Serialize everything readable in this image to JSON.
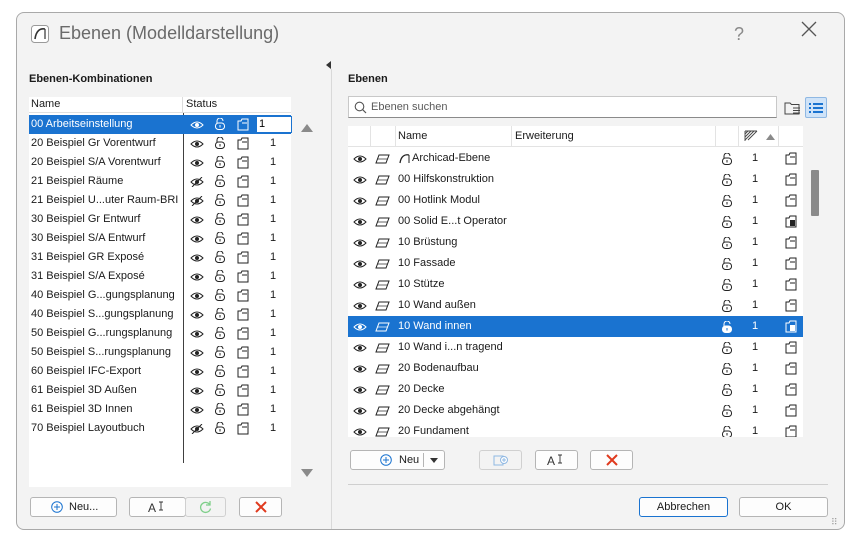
{
  "window": {
    "title": "Ebenen (Modelldarstellung)",
    "help_label": "?"
  },
  "left": {
    "section_title": "Ebenen-Kombinationen",
    "col_name": "Name",
    "col_status": "Status",
    "rows": [
      {
        "name": "00 Arbeitseinstellung",
        "num": "1",
        "hidden": false,
        "selected": true
      },
      {
        "name": "20 Beispiel Gr Vorentwurf",
        "num": "1",
        "hidden": false
      },
      {
        "name": "20 Beispiel S/A Vorentwurf",
        "num": "1",
        "hidden": false
      },
      {
        "name": "21 Beispiel Räume",
        "num": "1",
        "hidden": true
      },
      {
        "name": "21 Beispiel U...uter Raum-BRI",
        "num": "1",
        "hidden": true
      },
      {
        "name": "30 Beispiel Gr Entwurf",
        "num": "1",
        "hidden": false
      },
      {
        "name": "30 Beispiel S/A Entwurf",
        "num": "1",
        "hidden": false
      },
      {
        "name": "31 Beispiel GR Exposé",
        "num": "1",
        "hidden": false
      },
      {
        "name": "31 Beispiel S/A Exposé",
        "num": "1",
        "hidden": false
      },
      {
        "name": "40 Beispiel G...gungsplanung",
        "num": "1",
        "hidden": false
      },
      {
        "name": "40 Beispiel S...gungsplanung",
        "num": "1",
        "hidden": false
      },
      {
        "name": "50 Beispiel G...rungsplanung",
        "num": "1",
        "hidden": false
      },
      {
        "name": "50 Beispiel S...rungsplanung",
        "num": "1",
        "hidden": false
      },
      {
        "name": "60 Beispiel IFC-Export",
        "num": "1",
        "hidden": false
      },
      {
        "name": "61 Beispiel 3D Außen",
        "num": "1",
        "hidden": false
      },
      {
        "name": "61 Beispiel 3D Innen",
        "num": "1",
        "hidden": false
      },
      {
        "name": "70 Beispiel Layoutbuch",
        "num": "1",
        "hidden": true
      }
    ],
    "buttons": {
      "new_label": "Neu...",
      "rename_icon": "text-rename-icon",
      "update_icon": "refresh-icon",
      "delete_icon": "red-x-icon"
    }
  },
  "right": {
    "section_title": "Ebenen",
    "search_placeholder": "Ebenen suchen",
    "col_name": "Name",
    "col_extension": "Erweiterung",
    "rows": [
      {
        "name": "Archicad-Ebene",
        "num": "1",
        "archicad": true
      },
      {
        "name": "00 Hilfskonstruktion",
        "num": "1"
      },
      {
        "name": "00 Hotlink Modul",
        "num": "1"
      },
      {
        "name": "00 Solid E...t Operator",
        "num": "1",
        "solid": true
      },
      {
        "name": "10 Brüstung",
        "num": "1"
      },
      {
        "name": "10 Fassade",
        "num": "1"
      },
      {
        "name": "10 Stütze",
        "num": "1"
      },
      {
        "name": "10 Wand außen",
        "num": "1"
      },
      {
        "name": "10 Wand innen",
        "num": "1",
        "selected": true
      },
      {
        "name": "10 Wand i...n tragend",
        "num": "1"
      },
      {
        "name": "20 Bodenaufbau",
        "num": "1"
      },
      {
        "name": "20 Decke",
        "num": "1"
      },
      {
        "name": "20 Decke abgehängt",
        "num": "1"
      },
      {
        "name": "20 Fundament",
        "num": "1"
      }
    ],
    "buttons": {
      "new_label": "Neu",
      "cancel_label": "Abbrechen",
      "ok_label": "OK"
    }
  },
  "colors": {
    "selection": "#1a73d0",
    "delete_red": "#e03a1e",
    "update_green": "#3aa34a"
  }
}
